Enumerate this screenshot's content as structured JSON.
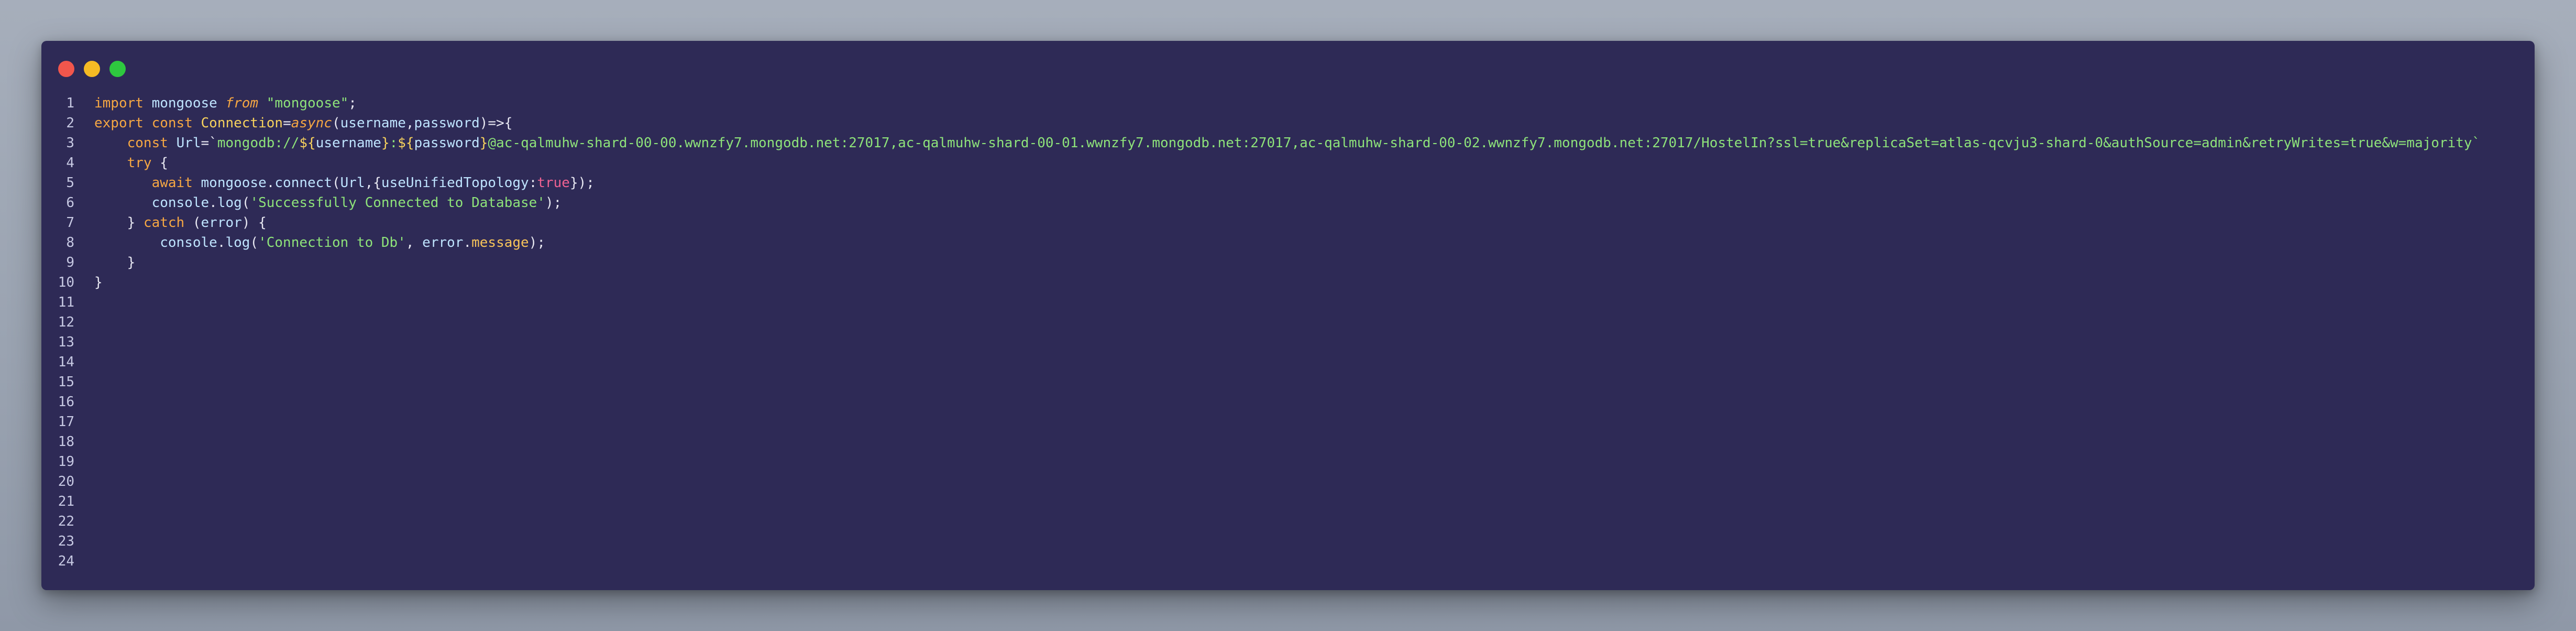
{
  "window": {
    "controls": [
      "close",
      "minimize",
      "maximize"
    ]
  },
  "editor": {
    "line_numbers": [
      "1",
      "2",
      "3",
      "4",
      "5",
      "6",
      "7",
      "8",
      "9",
      "10",
      "11",
      "12",
      "13",
      "14",
      "15",
      "16",
      "17",
      "18",
      "19",
      "20",
      "21",
      "22",
      "23",
      "24"
    ],
    "lines": [
      [
        {
          "t": "import",
          "c": "kw"
        },
        {
          "t": " ",
          "c": "plain"
        },
        {
          "t": "mongoose",
          "c": "id"
        },
        {
          "t": " ",
          "c": "plain"
        },
        {
          "t": "from",
          "c": "kw-it"
        },
        {
          "t": " ",
          "c": "plain"
        },
        {
          "t": "\"mongoose\"",
          "c": "str"
        },
        {
          "t": ";",
          "c": "pun"
        }
      ],
      [
        {
          "t": "export",
          "c": "kw"
        },
        {
          "t": " ",
          "c": "plain"
        },
        {
          "t": "const",
          "c": "kw"
        },
        {
          "t": " ",
          "c": "plain"
        },
        {
          "t": "Connection",
          "c": "fn"
        },
        {
          "t": "=",
          "c": "pun"
        },
        {
          "t": "async",
          "c": "kw-it"
        },
        {
          "t": "(",
          "c": "pun"
        },
        {
          "t": "username",
          "c": "id"
        },
        {
          "t": ",",
          "c": "pun"
        },
        {
          "t": "password",
          "c": "id"
        },
        {
          "t": ")=>{",
          "c": "pun"
        }
      ],
      [
        {
          "t": "    ",
          "c": "plain"
        },
        {
          "t": "const",
          "c": "kw"
        },
        {
          "t": " ",
          "c": "plain"
        },
        {
          "t": "Url",
          "c": "id"
        },
        {
          "t": "=`",
          "c": "pun"
        },
        {
          "t": "mongodb://",
          "c": "str"
        },
        {
          "t": "${",
          "c": "tmpl"
        },
        {
          "t": "username",
          "c": "id"
        },
        {
          "t": "}",
          "c": "tmpl"
        },
        {
          "t": ":",
          "c": "str"
        },
        {
          "t": "${",
          "c": "tmpl"
        },
        {
          "t": "password",
          "c": "id"
        },
        {
          "t": "}",
          "c": "tmpl"
        },
        {
          "t": "@ac-qalmuhw-shard-00-00.wwnzfy7.mongodb.net:27017,ac-qalmuhw-shard-00-01.wwnzfy7.mongodb.net:27017,ac-qalmuhw-shard-00-02.wwnzfy7.mongodb.net:27017/HostelIn?ssl=true&replicaSet=atlas-qcvju3-shard-0&authSource=admin&retryWrites=true&w=majority`",
          "c": "str"
        }
      ],
      [
        {
          "t": "    ",
          "c": "plain"
        },
        {
          "t": "try",
          "c": "kw"
        },
        {
          "t": " {",
          "c": "pun"
        }
      ],
      [
        {
          "t": "       ",
          "c": "plain"
        },
        {
          "t": "await",
          "c": "kw"
        },
        {
          "t": " ",
          "c": "plain"
        },
        {
          "t": "mongoose",
          "c": "id"
        },
        {
          "t": ".",
          "c": "pun"
        },
        {
          "t": "connect",
          "c": "id"
        },
        {
          "t": "(",
          "c": "pun"
        },
        {
          "t": "Url",
          "c": "id"
        },
        {
          "t": ",{",
          "c": "pun"
        },
        {
          "t": "useUnifiedTopology",
          "c": "id"
        },
        {
          "t": ":",
          "c": "pun"
        },
        {
          "t": "true",
          "c": "bool"
        },
        {
          "t": "});",
          "c": "pun"
        }
      ],
      [
        {
          "t": "       ",
          "c": "plain"
        },
        {
          "t": "console",
          "c": "id"
        },
        {
          "t": ".",
          "c": "pun"
        },
        {
          "t": "log",
          "c": "id"
        },
        {
          "t": "(",
          "c": "pun"
        },
        {
          "t": "'Successfully Connected to Database'",
          "c": "str"
        },
        {
          "t": ");",
          "c": "pun"
        }
      ],
      [
        {
          "t": "    ",
          "c": "plain"
        },
        {
          "t": "} ",
          "c": "pun"
        },
        {
          "t": "catch",
          "c": "kw"
        },
        {
          "t": " (",
          "c": "pun"
        },
        {
          "t": "error",
          "c": "id"
        },
        {
          "t": ") {",
          "c": "pun"
        }
      ],
      [
        {
          "t": "        ",
          "c": "plain"
        },
        {
          "t": "console",
          "c": "id"
        },
        {
          "t": ".",
          "c": "pun"
        },
        {
          "t": "log",
          "c": "id"
        },
        {
          "t": "(",
          "c": "pun"
        },
        {
          "t": "'Connection to Db'",
          "c": "str"
        },
        {
          "t": ", ",
          "c": "pun"
        },
        {
          "t": "error",
          "c": "id"
        },
        {
          "t": ".",
          "c": "pun"
        },
        {
          "t": "message",
          "c": "prop"
        },
        {
          "t": ");",
          "c": "pun"
        }
      ],
      [
        {
          "t": "    ",
          "c": "plain"
        },
        {
          "t": "}",
          "c": "pun"
        }
      ],
      [
        {
          "t": "}",
          "c": "pun"
        }
      ],
      [],
      [],
      [],
      [],
      [],
      [],
      [],
      [],
      [],
      [],
      [],
      [],
      [],
      []
    ]
  }
}
